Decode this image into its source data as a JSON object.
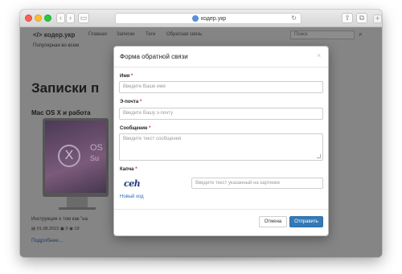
{
  "browser": {
    "url": "кодер.укр",
    "back_glyph": "‹",
    "forward_glyph": "›",
    "sidebar_glyph": "▭",
    "reload_glyph": "↻",
    "share_glyph": "⇪",
    "tabs_glyph": "⧉",
    "newtab_glyph": "+"
  },
  "site": {
    "logo": "</>  кодер.укр",
    "nav": [
      "Главная",
      "Записки",
      "Теги",
      "Обратная связь"
    ],
    "search_placeholder": "Поиск",
    "search_icon": "⌕",
    "topline": "Популярная во всем",
    "page_title": "Записки п",
    "post_title": "Mac OS X и работа",
    "screen_x": "X",
    "screen_os": "OS",
    "screen_su": "Su",
    "excerpt": "Инструкция о том как \"на",
    "meta": "▤ 01.08.2015    ▣ 0    ◉ 19",
    "read_more": "Подробнее..."
  },
  "modal": {
    "title": "Форма обратной связи",
    "close": "×",
    "name_label": "Имя",
    "name_placeholder": "Введите Ваше имя",
    "email_label": "Э-почта",
    "email_placeholder": "Введите Вашу э-почту",
    "message_label": "Сообщение",
    "message_placeholder": "Введите текст сообщения",
    "captcha_label": "Капча",
    "captcha_image_text": "ceh",
    "captcha_placeholder": "Введите текст указанный на картинке",
    "new_code": "Новый код",
    "required_mark": "*",
    "cancel_label": "Отмена",
    "send_label": "Отправить"
  }
}
